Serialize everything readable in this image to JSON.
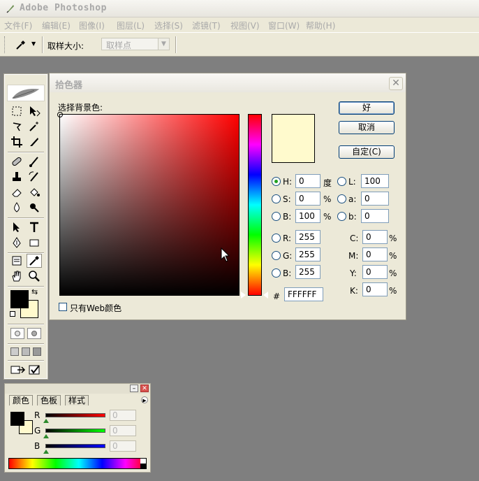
{
  "app": {
    "title": "Adobe Photoshop"
  },
  "menu": [
    "文件(F)",
    "编辑(E)",
    "图像(I)",
    "图层(L)",
    "选择(S)",
    "滤镜(T)",
    "视图(V)",
    "窗口(W)",
    "帮助(H)"
  ],
  "options": {
    "sample_size_label": "取样大小:",
    "sample_size_value": "取样点"
  },
  "dialog": {
    "title": "拾色器",
    "prompt": "选择背景色:",
    "swatch_color": "#FFFACD",
    "ok": "好",
    "cancel": "取消",
    "custom": "自定(C)",
    "web_only": "只有Web颜色",
    "hsb": {
      "h_label": "H:",
      "h": "0",
      "h_unit": "度",
      "s_label": "S:",
      "s": "0",
      "s_unit": "%",
      "b_label": "B:",
      "b": "100",
      "b_unit": "%"
    },
    "lab": {
      "l_label": "L:",
      "l": "100",
      "a_label": "a:",
      "a": "0",
      "b_label": "b:",
      "b": "0"
    },
    "rgb": {
      "r_label": "R:",
      "r": "255",
      "g_label": "G:",
      "g": "255",
      "b_label": "B:",
      "b": "255"
    },
    "cmyk": {
      "c_label": "C:",
      "c": "0",
      "c_unit": "%",
      "m_label": "M:",
      "m": "0",
      "m_unit": "%",
      "y_label": "Y:",
      "y": "0",
      "y_unit": "%",
      "k_label": "K:",
      "k": "0",
      "k_unit": "%"
    },
    "hex_label": "#",
    "hex": "FFFFFF"
  },
  "toolbox": {
    "foreground_color": "#000000",
    "background_color": "#FFFACD"
  },
  "color_panel": {
    "tabs": [
      "颜色",
      "色板",
      "样式"
    ],
    "r_label": "R",
    "r": "0",
    "g_label": "G",
    "g": "0",
    "b_label": "B",
    "b": "0"
  }
}
